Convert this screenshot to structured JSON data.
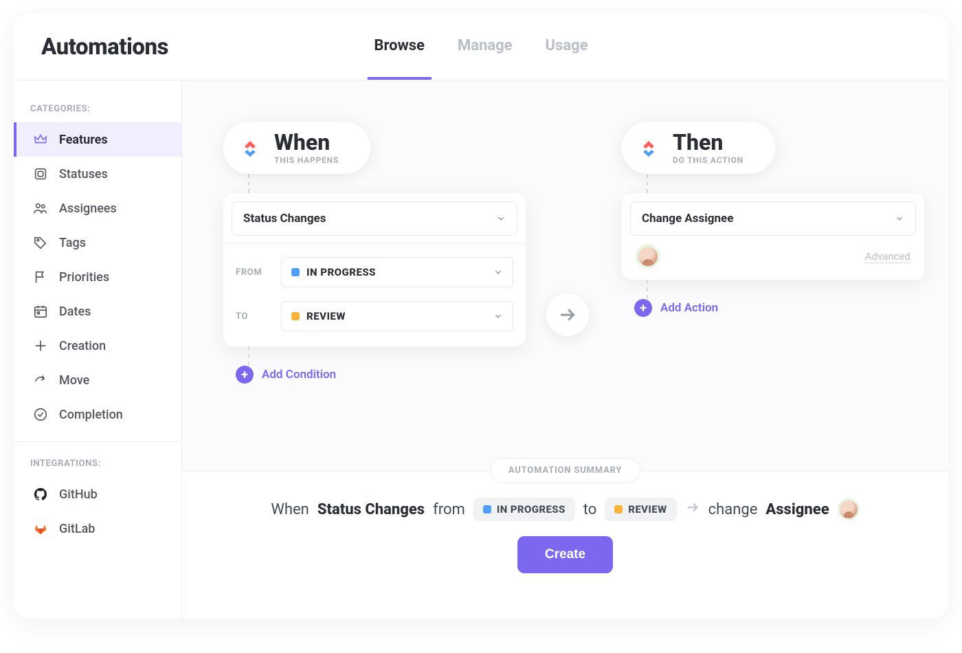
{
  "header": {
    "title": "Automations",
    "tabs": [
      "Browse",
      "Manage",
      "Usage"
    ],
    "active_tab": 0
  },
  "sidebar": {
    "categories_heading": "CATEGORIES:",
    "integrations_heading": "INTEGRATIONS:",
    "items": [
      {
        "label": "Features",
        "icon": "crown-icon",
        "active": true
      },
      {
        "label": "Statuses",
        "icon": "square-icon"
      },
      {
        "label": "Assignees",
        "icon": "people-icon"
      },
      {
        "label": "Tags",
        "icon": "tag-icon"
      },
      {
        "label": "Priorities",
        "icon": "flag-icon"
      },
      {
        "label": "Dates",
        "icon": "calendar-icon"
      },
      {
        "label": "Creation",
        "icon": "plus-icon"
      },
      {
        "label": "Move",
        "icon": "share-icon"
      },
      {
        "label": "Completion",
        "icon": "check-circle-icon"
      }
    ],
    "integrations": [
      {
        "label": "GitHub",
        "icon": "github-icon"
      },
      {
        "label": "GitLab",
        "icon": "gitlab-icon"
      }
    ]
  },
  "when": {
    "title": "When",
    "subtitle": "THIS HAPPENS",
    "trigger": "Status Changes",
    "from_label": "FROM",
    "to_label": "TO",
    "from_status": {
      "name": "IN PROGRESS",
      "color": "#4f9df8"
    },
    "to_status": {
      "name": "REVIEW",
      "color": "#f9b53b"
    },
    "add_condition": "Add Condition"
  },
  "then": {
    "title": "Then",
    "subtitle": "DO THIS ACTION",
    "action": "Change Assignee",
    "advanced": "Advanced",
    "add_action": "Add Action"
  },
  "summary": {
    "heading": "AUTOMATION SUMMARY",
    "when_word": "When",
    "trigger": "Status Changes",
    "from_word": "from",
    "from_status": {
      "name": "IN PROGRESS",
      "color": "#4f9df8"
    },
    "to_word": "to",
    "to_status": {
      "name": "REVIEW",
      "color": "#f9b53b"
    },
    "change_word": "change",
    "assignee_word": "Assignee",
    "create": "Create"
  },
  "colors": {
    "accent": "#7b68ee"
  }
}
